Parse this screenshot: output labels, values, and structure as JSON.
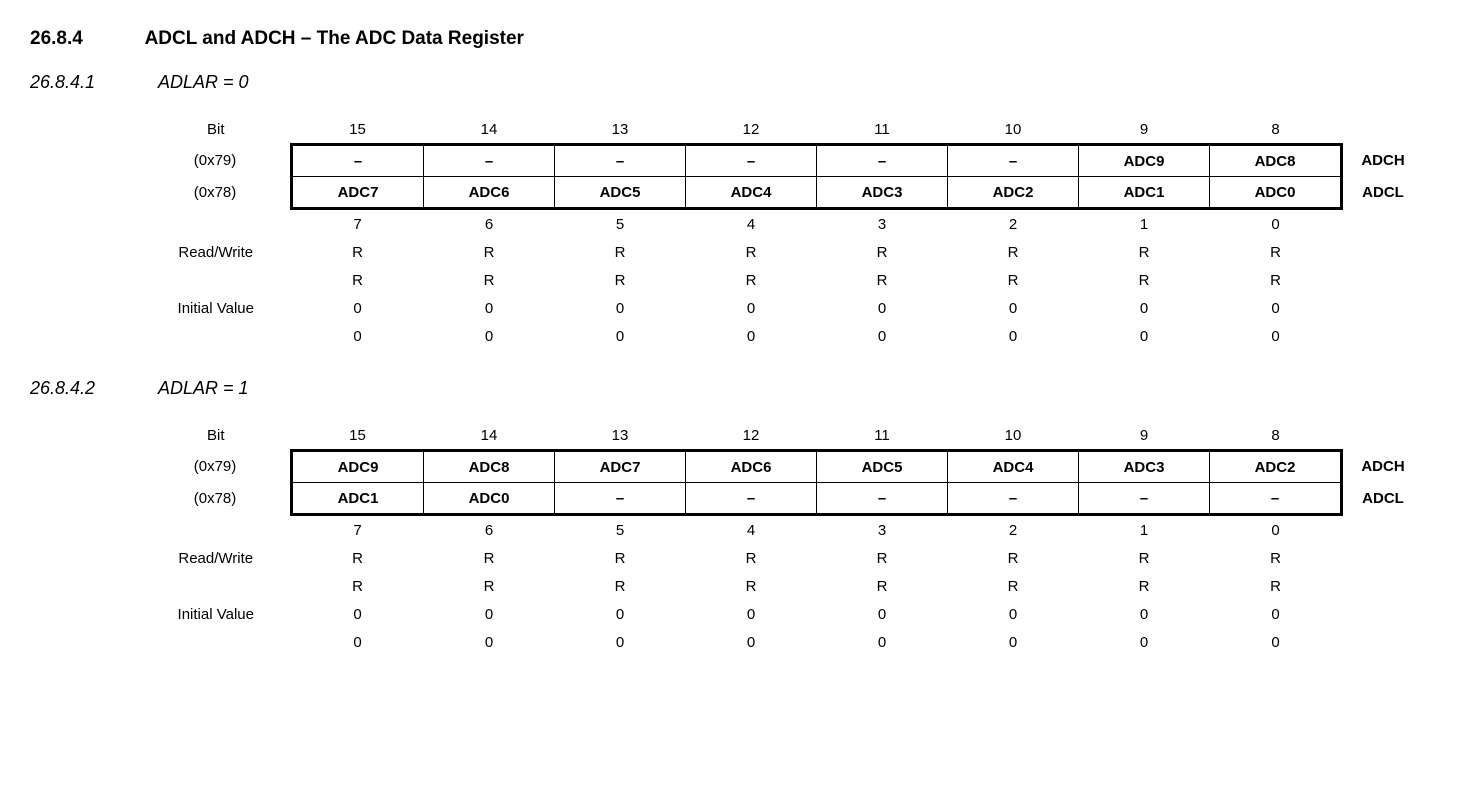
{
  "heading": {
    "num": "26.8.4",
    "title": "ADCL and ADCH – The ADC Data Register"
  },
  "sections": [
    {
      "num": "26.8.4.1",
      "title": "ADLAR = 0",
      "labels": {
        "bit": "Bit",
        "addr_h": "(0x79)",
        "addr_l": "(0x78)",
        "rw": "Read/Write",
        "iv": "Initial Value",
        "name_h": "ADCH",
        "name_l": "ADCL"
      },
      "bits_high": [
        "15",
        "14",
        "13",
        "12",
        "11",
        "10",
        "9",
        "8"
      ],
      "row_h": [
        "–",
        "–",
        "–",
        "–",
        "–",
        "–",
        "ADC9",
        "ADC8"
      ],
      "row_l": [
        "ADC7",
        "ADC6",
        "ADC5",
        "ADC4",
        "ADC3",
        "ADC2",
        "ADC1",
        "ADC0"
      ],
      "bits_low": [
        "7",
        "6",
        "5",
        "4",
        "3",
        "2",
        "1",
        "0"
      ],
      "rw1": [
        "R",
        "R",
        "R",
        "R",
        "R",
        "R",
        "R",
        "R"
      ],
      "rw2": [
        "R",
        "R",
        "R",
        "R",
        "R",
        "R",
        "R",
        "R"
      ],
      "iv1": [
        "0",
        "0",
        "0",
        "0",
        "0",
        "0",
        "0",
        "0"
      ],
      "iv2": [
        "0",
        "0",
        "0",
        "0",
        "0",
        "0",
        "0",
        "0"
      ]
    },
    {
      "num": "26.8.4.2",
      "title": "ADLAR = 1",
      "labels": {
        "bit": "Bit",
        "addr_h": "(0x79)",
        "addr_l": "(0x78)",
        "rw": "Read/Write",
        "iv": "Initial Value",
        "name_h": "ADCH",
        "name_l": "ADCL"
      },
      "bits_high": [
        "15",
        "14",
        "13",
        "12",
        "11",
        "10",
        "9",
        "8"
      ],
      "row_h": [
        "ADC9",
        "ADC8",
        "ADC7",
        "ADC6",
        "ADC5",
        "ADC4",
        "ADC3",
        "ADC2"
      ],
      "row_l": [
        "ADC1",
        "ADC0",
        "–",
        "–",
        "–",
        "–",
        "–",
        "–"
      ],
      "bits_low": [
        "7",
        "6",
        "5",
        "4",
        "3",
        "2",
        "1",
        "0"
      ],
      "rw1": [
        "R",
        "R",
        "R",
        "R",
        "R",
        "R",
        "R",
        "R"
      ],
      "rw2": [
        "R",
        "R",
        "R",
        "R",
        "R",
        "R",
        "R",
        "R"
      ],
      "iv1": [
        "0",
        "0",
        "0",
        "0",
        "0",
        "0",
        "0",
        "0"
      ],
      "iv2": [
        "0",
        "0",
        "0",
        "0",
        "0",
        "0",
        "0",
        "0"
      ]
    }
  ]
}
